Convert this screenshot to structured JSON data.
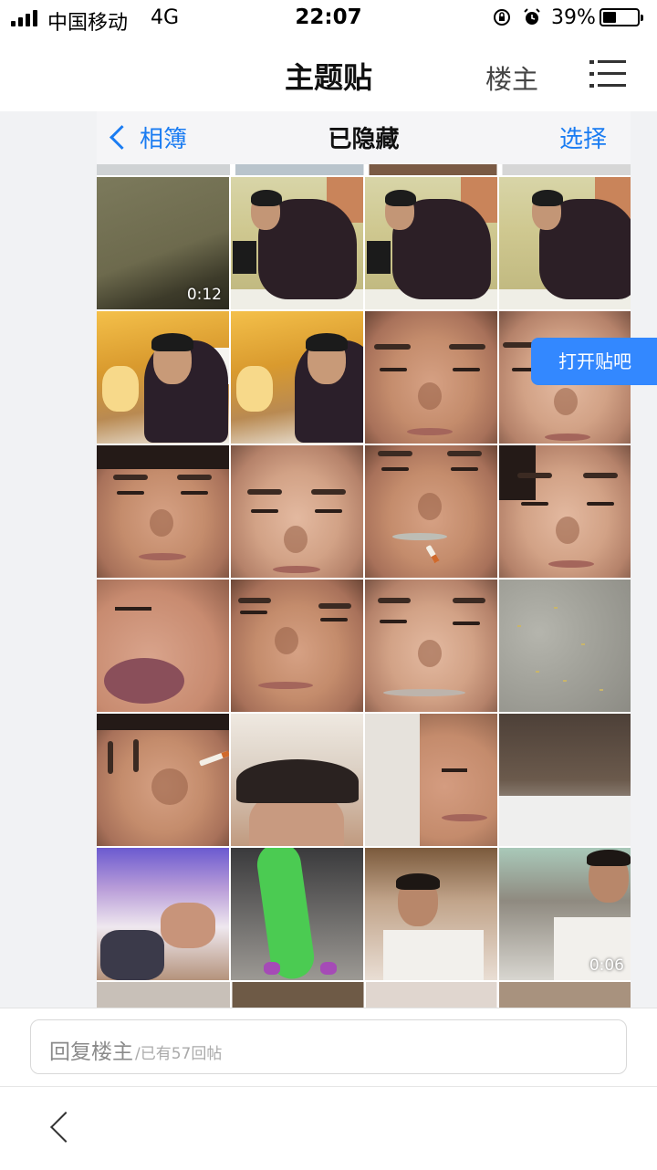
{
  "status_bar": {
    "carrier": "中国移动",
    "network": "4G",
    "time": "22:07",
    "battery_percent": "39%",
    "battery_level": 0.39,
    "icons": [
      "signal-icon",
      "orientation-lock-icon",
      "alarm-icon",
      "battery-icon"
    ]
  },
  "header": {
    "title": "主题贴",
    "owner_label": "楼主",
    "menu_icon": "menu-icon"
  },
  "post": {
    "screenshot": {
      "nav": {
        "back_label": "相簿",
        "title": "已隐藏",
        "select_label": "选择"
      },
      "durations": [
        "0:12",
        "0:06"
      ]
    },
    "open_tieba_label": "打开贴吧"
  },
  "reply": {
    "placeholder": "回复楼主",
    "count_text": "/已有57回帖"
  },
  "bottom": {
    "back_icon": "chevron-left-icon"
  }
}
